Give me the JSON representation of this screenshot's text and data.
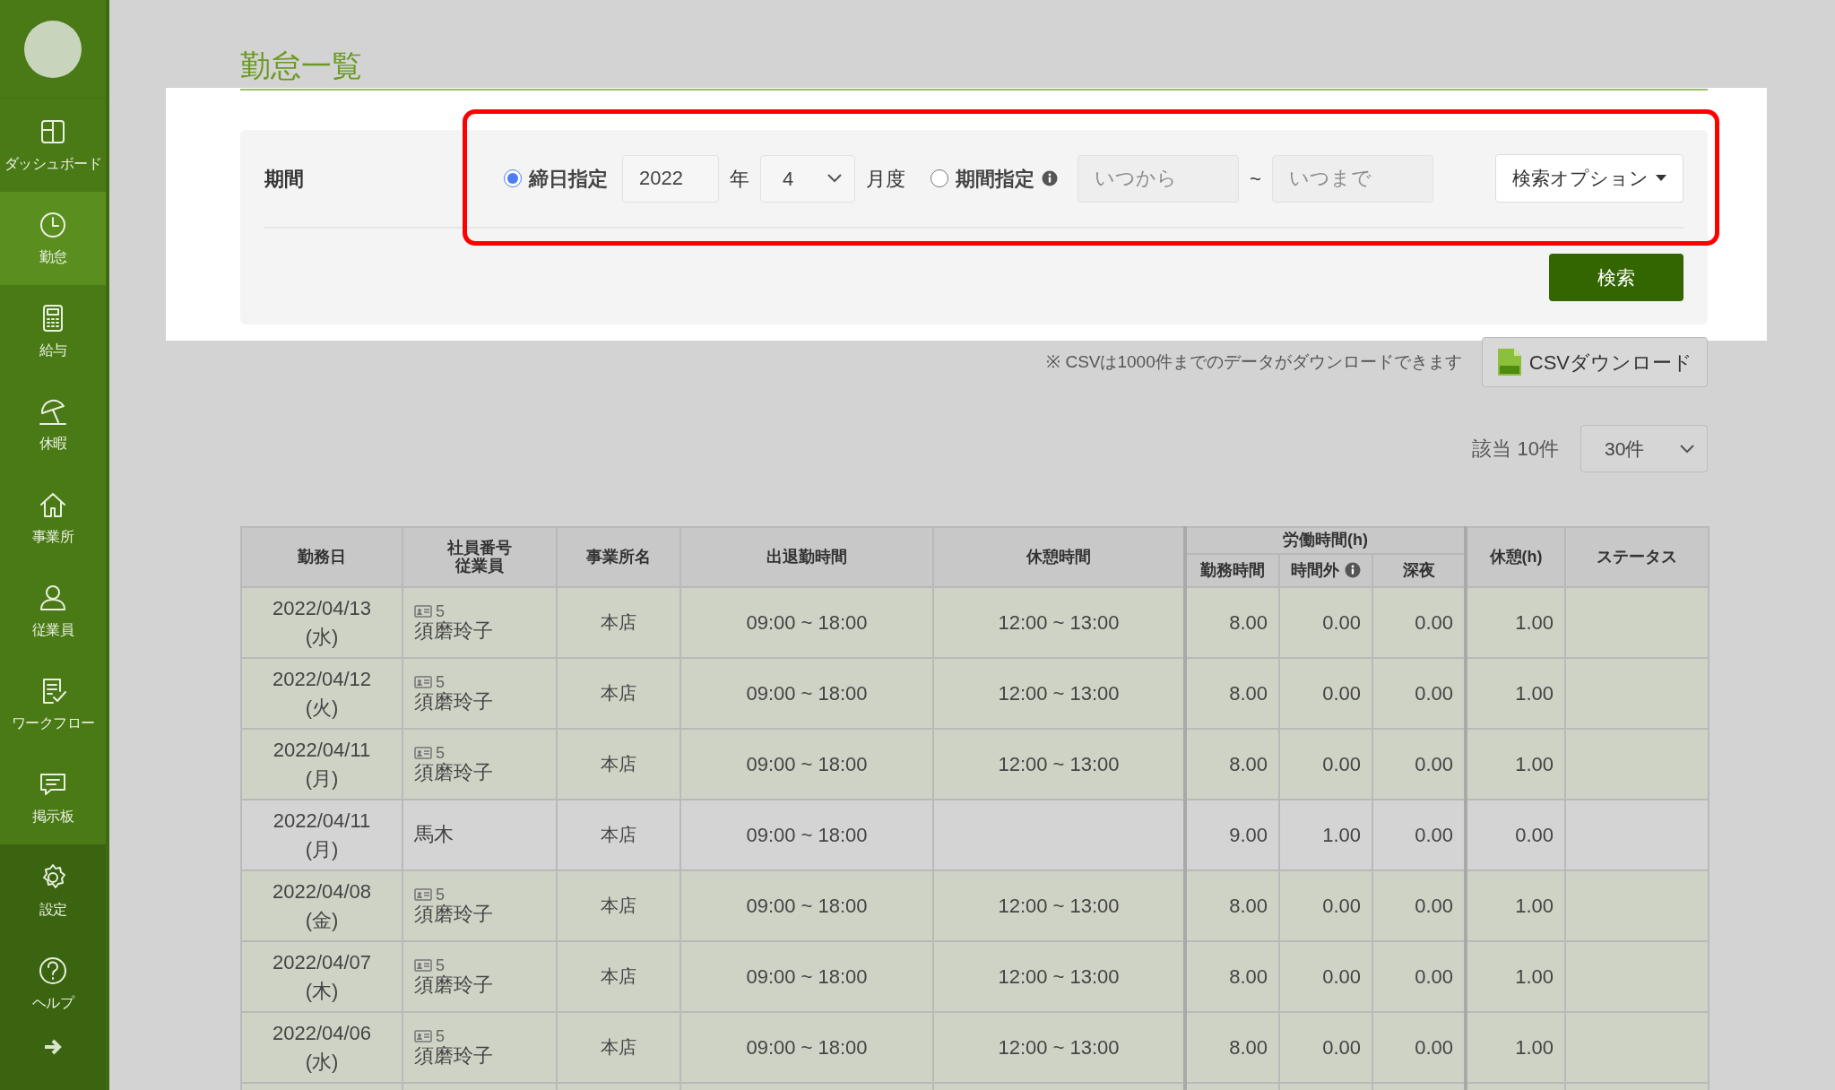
{
  "sidebar": {
    "items": [
      {
        "label": "ダッシュボード",
        "selected": false
      },
      {
        "label": "勤怠",
        "selected": true
      },
      {
        "label": "給与",
        "selected": false
      },
      {
        "label": "休暇",
        "selected": false
      },
      {
        "label": "事業所",
        "selected": false
      },
      {
        "label": "従業員",
        "selected": false
      },
      {
        "label": "ワークフロー",
        "selected": false
      },
      {
        "label": "掲示板",
        "selected": false
      },
      {
        "label": "設定",
        "selected": false
      },
      {
        "label": "ヘルプ",
        "selected": false
      }
    ]
  },
  "page_title": "勤怠一覧",
  "filter": {
    "label": "期間",
    "modes": [
      {
        "label": "締日指定",
        "selected": true,
        "kind": "closing"
      },
      {
        "label": "期間指定",
        "selected": false,
        "kind": "range"
      }
    ],
    "year": "2022",
    "year_unit": "年",
    "month": "4",
    "month_unit": "月度",
    "from": {
      "placeholder": "いつから"
    },
    "separator": "~",
    "to": {
      "placeholder": "いつまで"
    },
    "options_button": "検索オプション",
    "search_button": "検索"
  },
  "csv_note": "※ CSVは1000件までのデータがダウンロードできます",
  "csv_button": "CSVダウンロード",
  "result_count": "該当 10件",
  "per_page": "30件",
  "table": {
    "columns": [
      "勤務日",
      "社員番号",
      "従業員",
      "事業所名",
      "出退勤時間",
      "休憩時間",
      "労働時間(h)",
      "勤務時間",
      "時間外",
      "深夜",
      "休憩(h)",
      "ステータス"
    ],
    "rows": [
      {
        "date": "2022/04/13",
        "weekday": "(水)",
        "employee_id": "5",
        "employee": "須磨玲子",
        "office": "本店",
        "in_out": "09:00 ~ 18:00",
        "break": "12:00 ~ 13:00",
        "work": "8.00",
        "overtime": "0.00",
        "night": "0.00",
        "rest": "1.00",
        "tinted": true
      },
      {
        "date": "2022/04/12",
        "weekday": "(火)",
        "employee_id": "5",
        "employee": "須磨玲子",
        "office": "本店",
        "in_out": "09:00 ~ 18:00",
        "break": "12:00 ~ 13:00",
        "work": "8.00",
        "overtime": "0.00",
        "night": "0.00",
        "rest": "1.00",
        "tinted": true
      },
      {
        "date": "2022/04/11",
        "weekday": "(月)",
        "employee_id": "5",
        "employee": "須磨玲子",
        "office": "本店",
        "in_out": "09:00 ~ 18:00",
        "break": "12:00 ~ 13:00",
        "work": "8.00",
        "overtime": "0.00",
        "night": "0.00",
        "rest": "1.00",
        "tinted": true
      },
      {
        "date": "2022/04/11",
        "weekday": "(月)",
        "employee": "馬木",
        "office": "本店",
        "in_out": "09:00 ~ 18:00",
        "work": "9.00",
        "overtime": "1.00",
        "night": "0.00",
        "rest": "0.00",
        "tinted": false
      },
      {
        "date": "2022/04/08",
        "weekday": "(金)",
        "employee_id": "5",
        "employee": "須磨玲子",
        "office": "本店",
        "in_out": "09:00 ~ 18:00",
        "break": "12:00 ~ 13:00",
        "work": "8.00",
        "overtime": "0.00",
        "night": "0.00",
        "rest": "1.00",
        "tinted": true
      },
      {
        "date": "2022/04/07",
        "weekday": "(木)",
        "employee_id": "5",
        "employee": "須磨玲子",
        "office": "本店",
        "in_out": "09:00 ~ 18:00",
        "break": "12:00 ~ 13:00",
        "work": "8.00",
        "overtime": "0.00",
        "night": "0.00",
        "rest": "1.00",
        "tinted": true
      },
      {
        "date": "2022/04/06",
        "weekday": "(水)",
        "employee_id": "5",
        "employee": "須磨玲子",
        "office": "本店",
        "in_out": "09:00 ~ 18:00",
        "break": "12:00 ~ 13:00",
        "work": "8.00",
        "overtime": "0.00",
        "night": "0.00",
        "rest": "1.00",
        "tinted": true
      }
    ]
  }
}
